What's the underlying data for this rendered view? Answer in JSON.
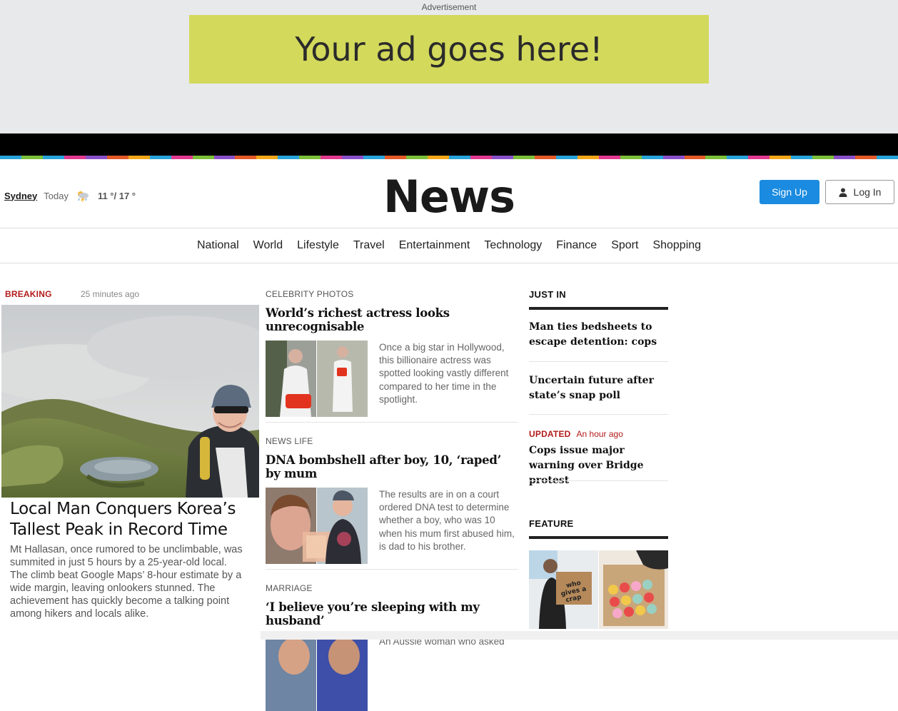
{
  "ad": {
    "label": "Advertisement",
    "text": "Your ad goes here!"
  },
  "stripe_colors": [
    "#29a3d9",
    "#7cbf3a",
    "#29a3d9",
    "#e13a8f",
    "#8a4fc9",
    "#e35a29",
    "#f2a71b",
    "#29a3d9",
    "#e13a8f",
    "#7cbf3a",
    "#8a4fc9",
    "#e35a29",
    "#f2a71b",
    "#29a3d9",
    "#7cbf3a",
    "#e13a8f",
    "#8a4fc9",
    "#29a3d9",
    "#e35a29",
    "#7cbf3a",
    "#f2a71b",
    "#29a3d9",
    "#e13a8f",
    "#8a4fc9",
    "#7cbf3a",
    "#e35a29",
    "#29a3d9",
    "#f2a71b",
    "#e13a8f",
    "#7cbf3a",
    "#29a3d9",
    "#8a4fc9",
    "#e35a29",
    "#7cbf3a",
    "#29a3d9",
    "#e13a8f",
    "#f2a71b",
    "#29a3d9",
    "#7cbf3a",
    "#8a4fc9",
    "#e35a29",
    "#29a3d9"
  ],
  "header": {
    "city": "Sydney",
    "today": "Today",
    "weather_icon": "storm-cloud-icon",
    "temp": "11 °/ 17 °",
    "logo": "News",
    "signup_label": "Sign Up",
    "login_label": "Log In"
  },
  "nav": [
    "National",
    "World",
    "Lifestyle",
    "Travel",
    "Entertainment",
    "Technology",
    "Finance",
    "Sport",
    "Shopping"
  ],
  "featured": {
    "tag": "BREAKING",
    "time": "25 minutes ago",
    "title": "Local Man Conquers Korea’s Tallest Peak in Record Time",
    "desc": "Mt Hallasan, once rumored to be unclimbable, was summited in just 5 hours by a 25-year-old local.\nThe climb beat Google Maps’ 8-hour estimate by a wide margin, leaving onlookers stunned. The achievement has quickly become a talking point among hikers and locals alike."
  },
  "stories": [
    {
      "category": "CELEBRITY PHOTOS",
      "title": "World’s richest actress looks unrecognisable",
      "desc": "Once a big star in Hollywood, this billionaire actress was spotted looking vastly different compared to her time in the spotlight."
    },
    {
      "category": "NEWS LIFE",
      "title": "DNA bombshell after boy, 10, ‘raped’ by mum",
      "desc": "The results are in on a court ordered DNA test to determine whether a boy, who was 10 when his mum first abused him, is dad to his brother."
    },
    {
      "category": "MARRIAGE",
      "title": "‘I believe you’re sleeping with my husband’",
      "desc": "An Aussie woman who asked"
    }
  ],
  "just_in": {
    "title": "JUST IN",
    "items": [
      {
        "title": "Man ties bedsheets to escape detention: cops"
      },
      {
        "title": "Uncertain future after state’s snap poll"
      },
      {
        "tag": "UPDATED",
        "time": "An hour ago",
        "title": "Cops issue major warning over Bridge protest"
      }
    ]
  },
  "feature": {
    "title": "FEATURE",
    "box_text": "who gives a crap"
  }
}
